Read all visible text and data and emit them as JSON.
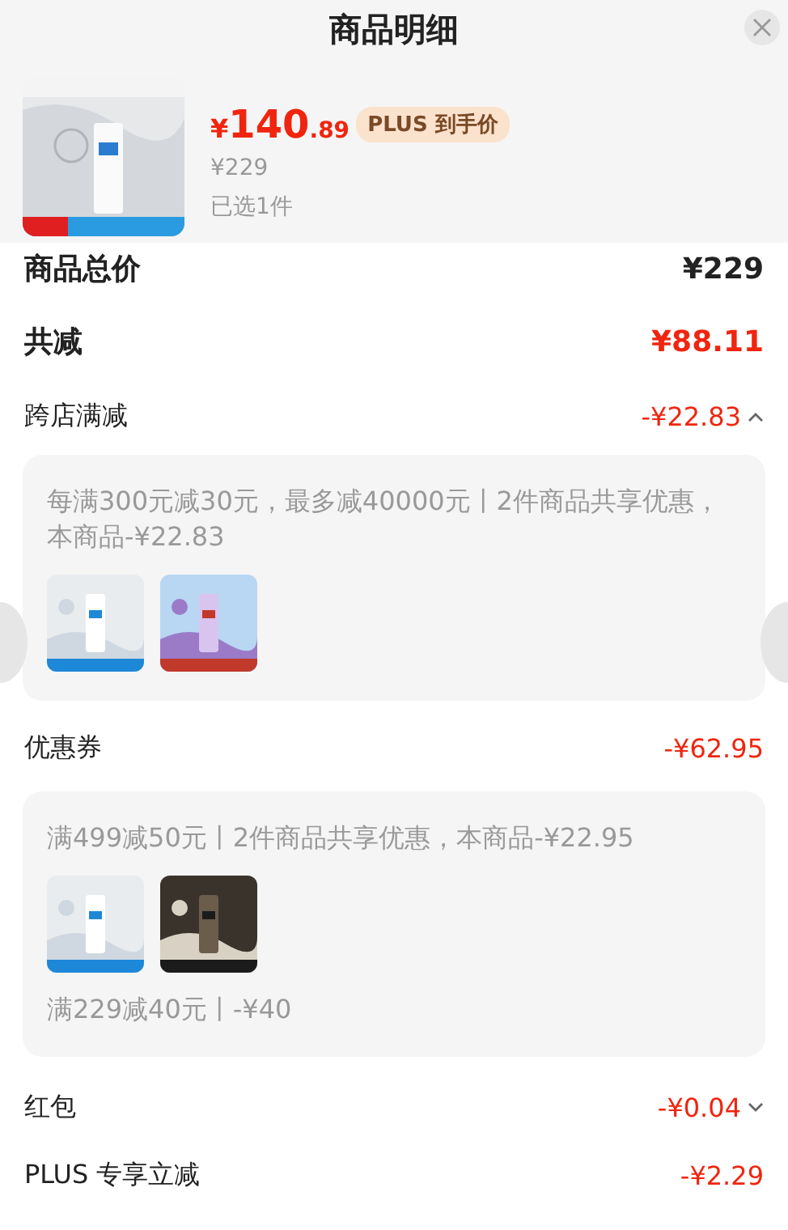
{
  "header": {
    "title": "商品明细"
  },
  "product": {
    "currency": "¥",
    "price": "140",
    "price_decimal": ".89",
    "badge": "PLUS 到手价",
    "original_price": "¥229",
    "selected_count": "已选1件"
  },
  "summary": [
    {
      "label": "商品总价",
      "value": "¥229",
      "kind": "total"
    },
    {
      "label": "共减",
      "value": "¥88.11",
      "kind": "reduction"
    }
  ],
  "discounts": [
    {
      "label": "跨店满减",
      "amount": "-¥22.83",
      "expanded": true,
      "details": [
        {
          "kind": "text",
          "text": "每满300元减30元，最多减40000元丨2件商品共享优惠，本商品-¥22.83"
        },
        {
          "kind": "thumbnails"
        }
      ]
    },
    {
      "label": "优惠券",
      "amount": "-¥62.95",
      "details": [
        {
          "kind": "text",
          "text": "满499减50元丨2件商品共享优惠，本商品-¥22.95"
        },
        {
          "kind": "thumbnails"
        },
        {
          "kind": "text",
          "text": "满229减40元丨-¥40"
        }
      ]
    },
    {
      "label": "红包",
      "amount": "-¥0.04",
      "expanded": false
    },
    {
      "label": "PLUS 专享立减",
      "amount": "-¥2.29"
    }
  ]
}
